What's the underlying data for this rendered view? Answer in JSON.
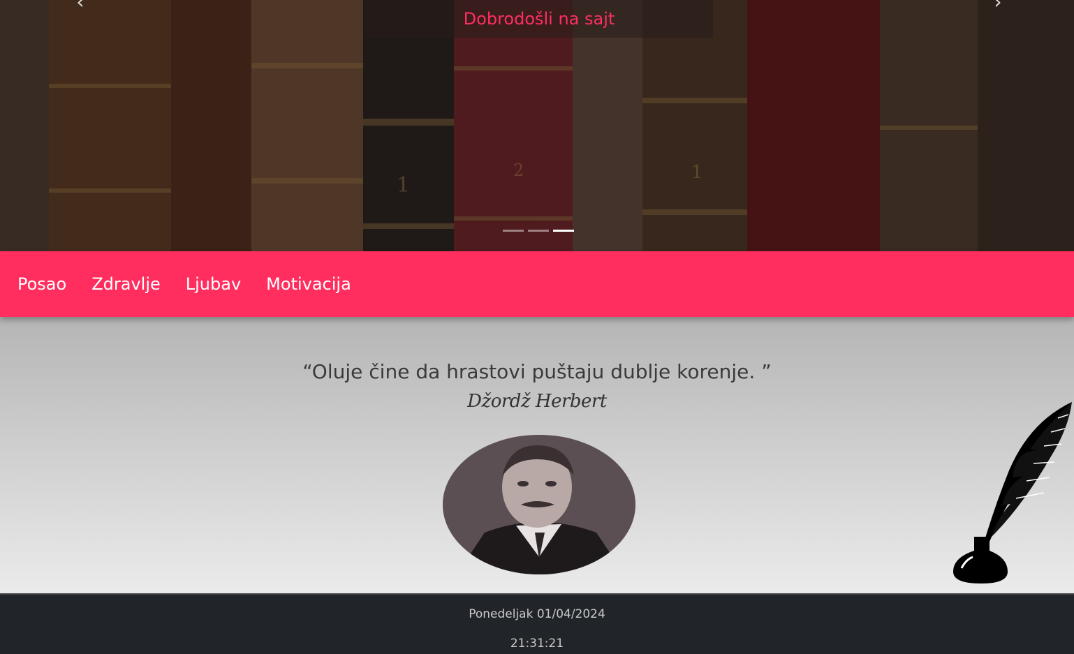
{
  "hero": {
    "welcome_text": "Dobrodošli na sajt",
    "prev_icon": "chevron-left-icon",
    "next_icon": "chevron-right-icon",
    "slide_count": 3,
    "active_slide": 3
  },
  "nav": {
    "items": [
      {
        "label": "Posao"
      },
      {
        "label": "Zdravlje"
      },
      {
        "label": "Ljubav"
      },
      {
        "label": "Motivacija"
      }
    ]
  },
  "quote": {
    "text": "“Oluje čine da hrastovi puštaju dublje korenje. ”",
    "author": "Džordž Herbert"
  },
  "footer": {
    "date": "Ponedeljak 01/04/2024",
    "time": "21:31:21"
  },
  "colors": {
    "accent": "#ff2e5f",
    "footer_bg": "#212529"
  }
}
